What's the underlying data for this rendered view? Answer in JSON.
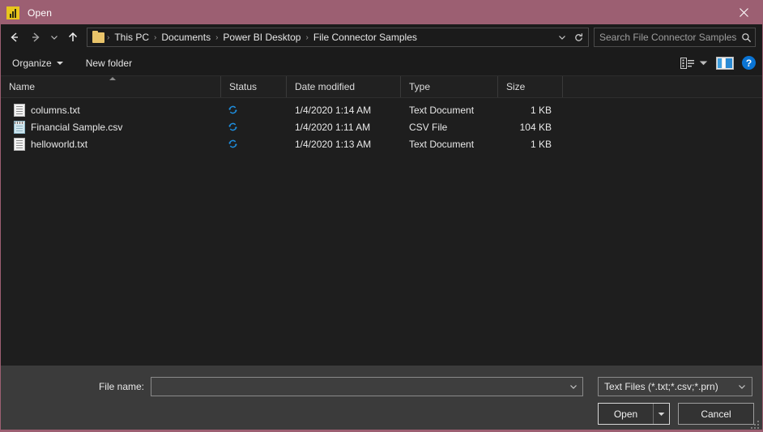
{
  "window": {
    "title": "Open",
    "app_icon": "power-bi-icon",
    "close_label": "✕",
    "accent_color": "#9c5f72",
    "background_color": "#1e1e1e"
  },
  "nav": {
    "back": "back-arrow",
    "forward": "forward-arrow",
    "recent": "recent-locations-chevron",
    "up": "up-arrow"
  },
  "address": {
    "folder_icon": "folder-icon",
    "crumbs": [
      "This PC",
      "Documents",
      "Power BI Desktop",
      "File Connector Samples"
    ],
    "separator": "›",
    "dropdown_icon": "chevron-down-icon",
    "refresh_icon": "refresh-icon"
  },
  "search": {
    "placeholder": "Search File Connector Samples",
    "icon": "search-icon"
  },
  "commandbar": {
    "organize": "Organize",
    "new_folder": "New folder",
    "view_icon": "view-options-icon",
    "preview_icon": "preview-pane-icon",
    "help_label": "?"
  },
  "columns": [
    {
      "label": "Name",
      "sorted": "ascending"
    },
    {
      "label": "Status"
    },
    {
      "label": "Date modified"
    },
    {
      "label": "Type"
    },
    {
      "label": "Size"
    }
  ],
  "files": [
    {
      "name": "columns.txt",
      "icon": "text-file-icon",
      "status_icon": "onedrive-sync-icon",
      "date_modified": "1/4/2020 1:14 AM",
      "type": "Text Document",
      "size": "1 KB"
    },
    {
      "name": "Financial Sample.csv",
      "icon": "csv-file-icon",
      "status_icon": "onedrive-sync-icon",
      "date_modified": "1/4/2020 1:11 AM",
      "type": "CSV File",
      "size": "104 KB"
    },
    {
      "name": "helloworld.txt",
      "icon": "text-file-icon",
      "status_icon": "onedrive-sync-icon",
      "date_modified": "1/4/2020 1:13 AM",
      "type": "Text Document",
      "size": "1 KB"
    }
  ],
  "footer": {
    "filename_label": "File name:",
    "filename_value": "",
    "filename_placeholder": "",
    "filetype_value": "Text Files (*.txt;*.csv;*.prn)",
    "open_label": "Open",
    "cancel_label": "Cancel"
  }
}
